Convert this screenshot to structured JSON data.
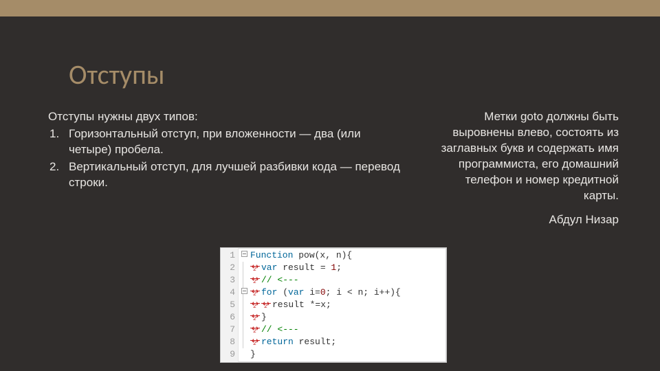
{
  "title": "Отступы",
  "left": {
    "intro": "Отступы нужны двух типов:",
    "items": [
      "Горизонтальный отступ, при вложенности — два (или четыре) пробела.",
      "Вертикальный отступ, для лучшей разбивки кода — перевод строки."
    ]
  },
  "right": {
    "quote": "Метки goto должны быть выровнены влево, состоять из заглавных букв и содержать имя программиста, его домашний телефон и номер кредитной карты.",
    "author": "Абдул Низар"
  },
  "code": {
    "line_numbers": [
      "1",
      "2",
      "3",
      "4",
      "5",
      "6",
      "7",
      "8",
      "9"
    ],
    "indent_size": "2",
    "lines": {
      "l1_a": "Function",
      "l1_b": " pow(x, n){",
      "l2_a": "var",
      "l2_b": " result = ",
      "l2_c": "1",
      "l2_d": ";",
      "l3": "// <---",
      "l4_a": "for",
      "l4_b": " (",
      "l4_c": "var",
      "l4_d": " i=",
      "l4_e": "0",
      "l4_f": "; i < n; i++){",
      "l5": "result *=x;",
      "l6": "}",
      "l7": "// <---",
      "l8_a": "return",
      "l8_b": " result;",
      "l9": "}"
    }
  }
}
